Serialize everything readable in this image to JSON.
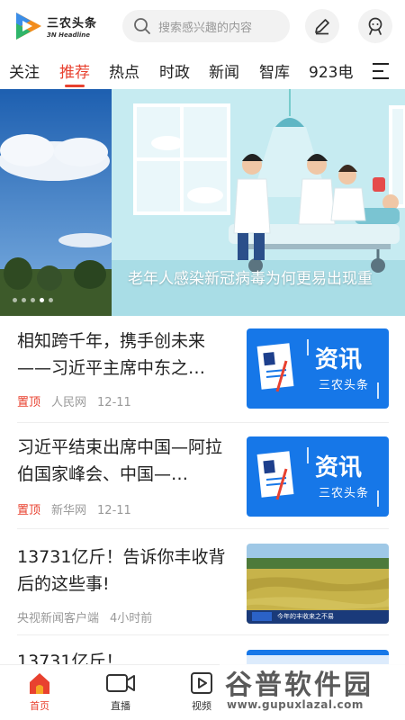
{
  "header": {
    "logo_cn": "三农头条",
    "logo_en": "3N Headline",
    "search_placeholder": "搜索感兴趣的内容",
    "brand_color": "#e8412f"
  },
  "tabs": [
    {
      "label": "关注"
    },
    {
      "label": "推荐",
      "active": true
    },
    {
      "label": "热点"
    },
    {
      "label": "时政"
    },
    {
      "label": "新闻"
    },
    {
      "label": "智库"
    },
    {
      "label": "923电"
    }
  ],
  "banner": {
    "caption": "老年人感染新冠病毒为何更易出现重"
  },
  "news": [
    {
      "title": "相知跨千年，携手创未来——习近平主席中东之…",
      "pin": "置顶",
      "source": "人民网",
      "date": "12-11",
      "thumb_title": "资讯",
      "thumb_sub": "三农头条"
    },
    {
      "title": "习近平结束出席中国—阿拉伯国家峰会、中国—…",
      "pin": "置顶",
      "source": "新华网",
      "date": "12-11",
      "thumb_title": "资讯",
      "thumb_sub": "三农头条"
    },
    {
      "title": "13731亿斤！告诉你丰收背后的这些事!",
      "source": "央视新闻客户端",
      "date": "4小时前",
      "thumb_caption": "今年的丰收来之不易"
    },
    {
      "title": "13731亿斤！"
    }
  ],
  "bottom_nav": [
    {
      "label": "首页",
      "icon": "home-icon",
      "active": true
    },
    {
      "label": "直播",
      "icon": "video-camera-icon"
    },
    {
      "label": "视频",
      "icon": "play-icon"
    }
  ],
  "watermark": {
    "cn": "谷普软件园",
    "en": "www.gupuxlazal.com"
  }
}
